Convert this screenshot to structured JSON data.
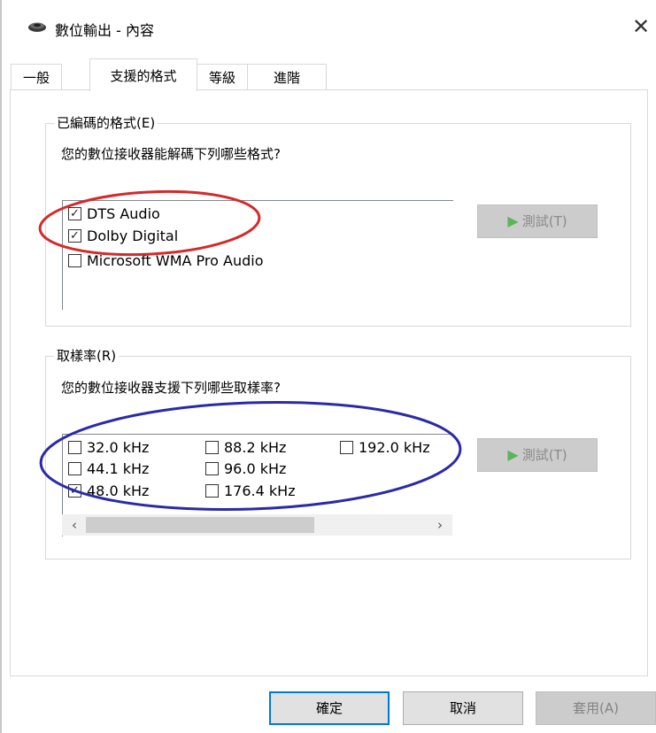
{
  "window": {
    "title": "數位輸出 - 內容",
    "app_icon": "speaker-icon",
    "close_glyph": "✕"
  },
  "tabs": [
    {
      "label": "一般",
      "active": false
    },
    {
      "label": "支援的格式",
      "active": true
    },
    {
      "label": "等級",
      "active": false
    },
    {
      "label": "進階",
      "active": false
    }
  ],
  "encoded_formats": {
    "legend": "已編碼的格式(E)",
    "prompt": "您的數位接收器能解碼下列哪些格式?",
    "items": [
      {
        "label": "DTS Audio",
        "checked": true
      },
      {
        "label": "Dolby Digital",
        "checked": true
      },
      {
        "label": "Microsoft WMA Pro Audio",
        "checked": false
      }
    ],
    "test_button": "測試(T)"
  },
  "sample_rates": {
    "legend": "取樣率(R)",
    "prompt": "您的數位接收器支援下列哪些取樣率?",
    "items": [
      {
        "label": "32.0 kHz",
        "checked": false
      },
      {
        "label": "44.1 kHz",
        "checked": false
      },
      {
        "label": "48.0 kHz",
        "checked": true
      },
      {
        "label": "88.2 kHz",
        "checked": false
      },
      {
        "label": "96.0 kHz",
        "checked": false
      },
      {
        "label": "176.4 kHz",
        "checked": false
      },
      {
        "label": "192.0 kHz",
        "checked": false
      }
    ],
    "test_button": "測試(T)",
    "scroll_left": "‹",
    "scroll_right": "›"
  },
  "footer": {
    "ok": "確定",
    "cancel": "取消",
    "apply": "套用(A)"
  },
  "colors": {
    "annotation_red": "#d42a2a",
    "annotation_blue": "#2a2aa8",
    "accent": "#0078d7",
    "play_green": "#5bb55b"
  }
}
